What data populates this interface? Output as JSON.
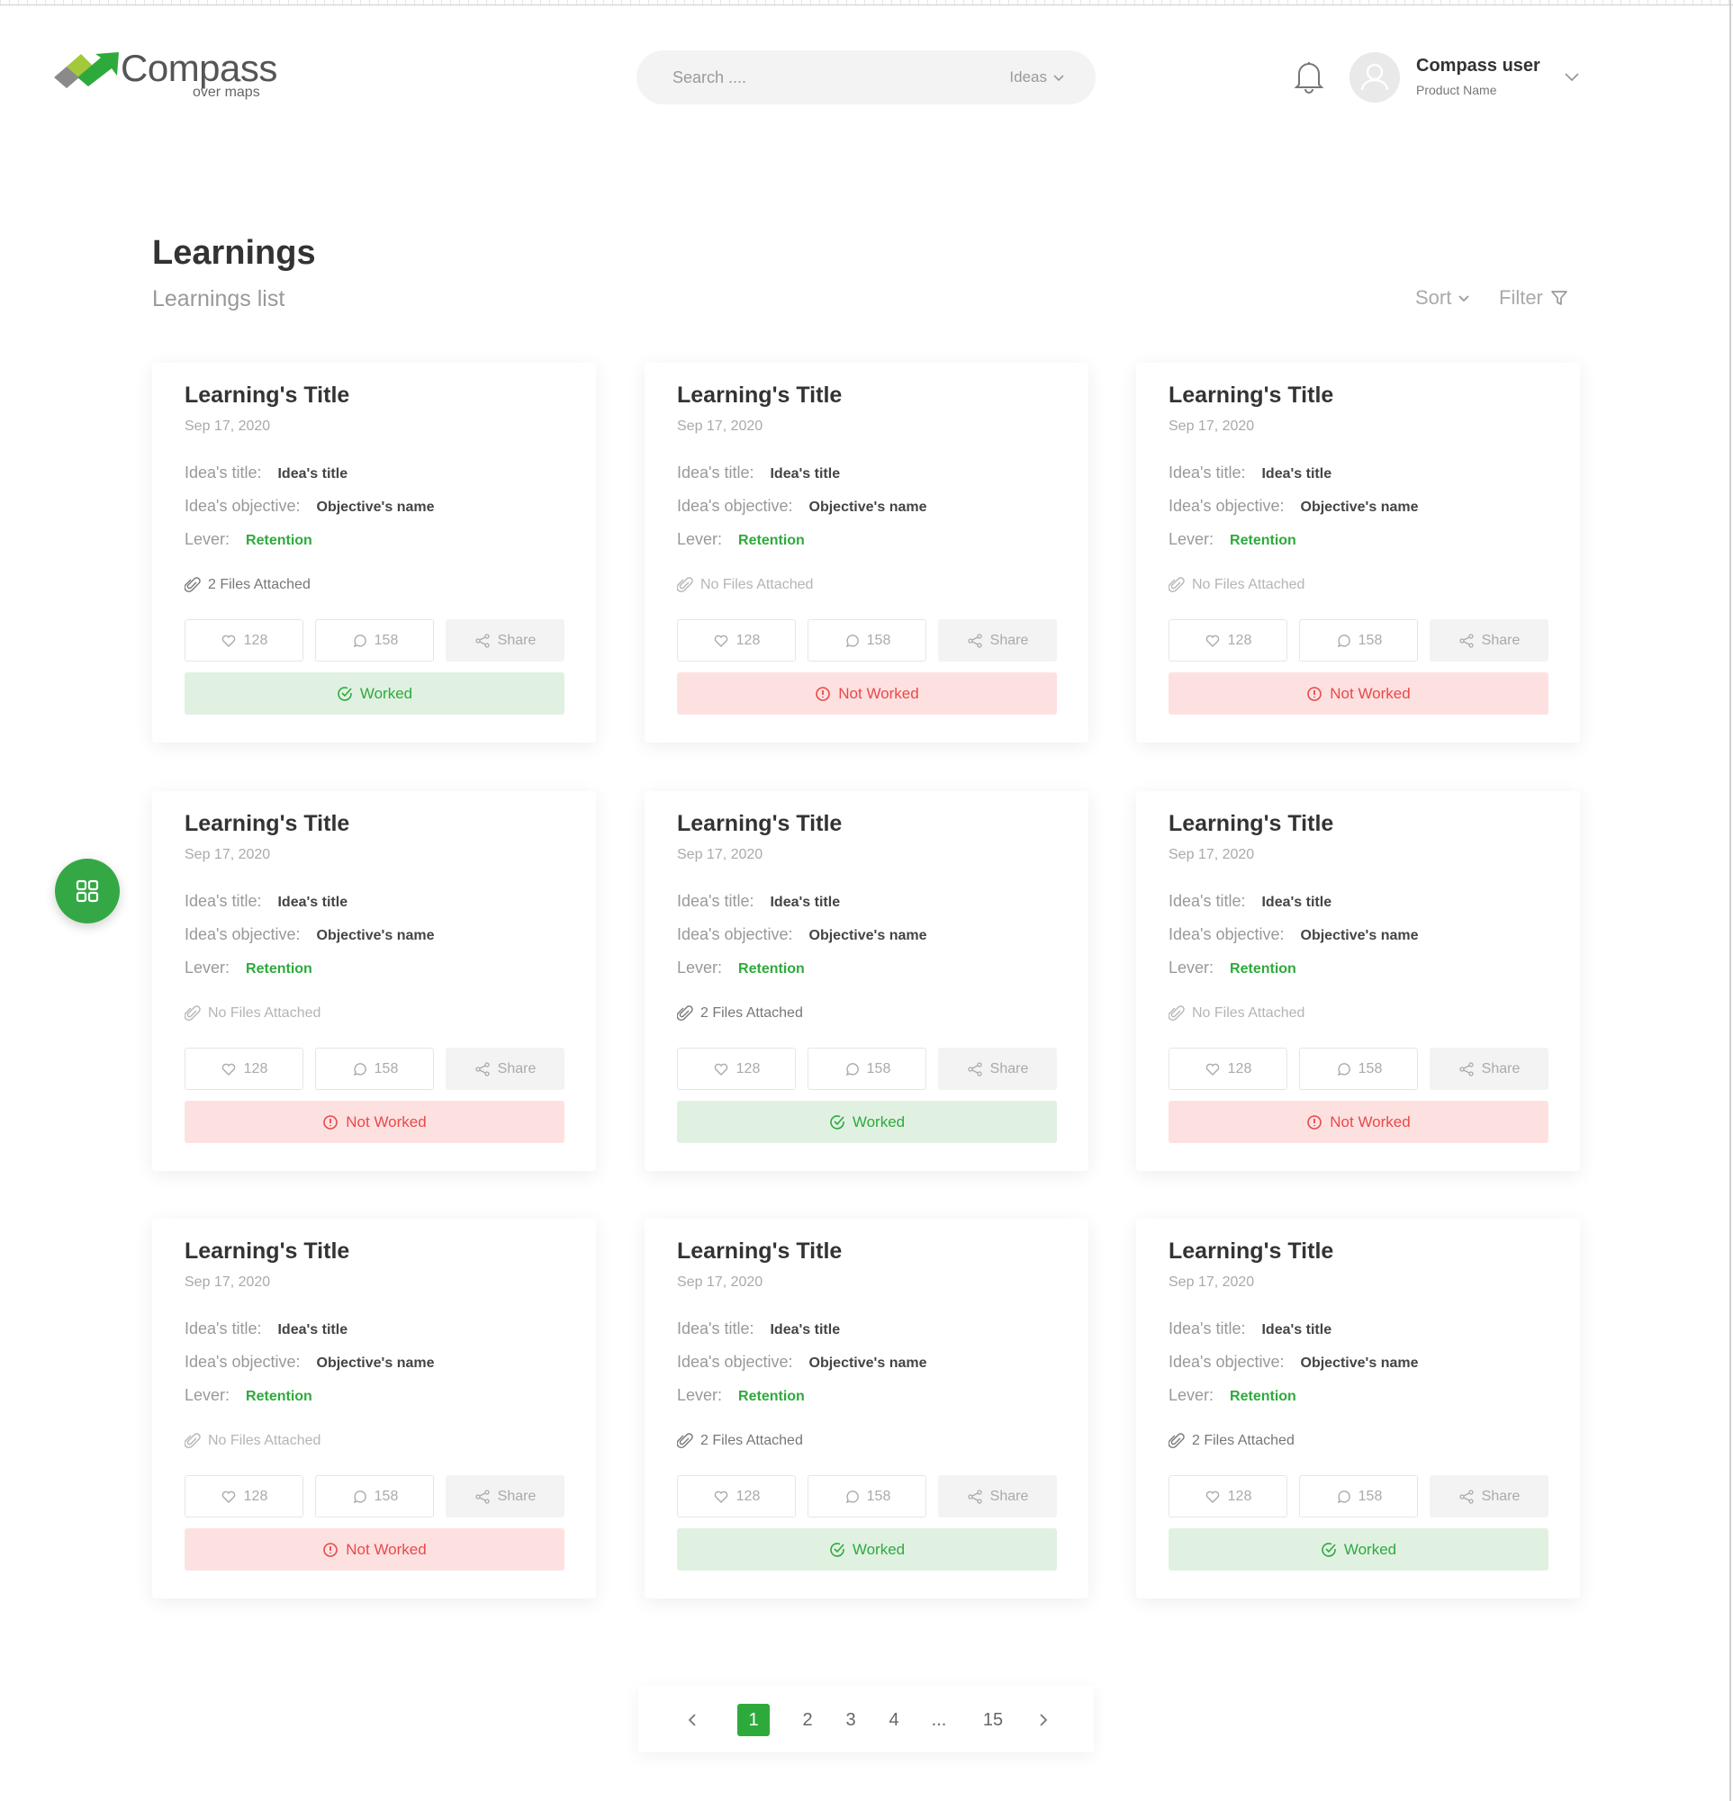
{
  "brand": {
    "name": "Compass",
    "tagline": "over maps",
    "green": "#2eaa3c",
    "red": "#ea4848"
  },
  "search": {
    "placeholder": "Search ....",
    "scope": "Ideas"
  },
  "user": {
    "name": "Compass user",
    "product": "Product Name"
  },
  "page": {
    "title": "Learnings",
    "subtitle": "Learnings list",
    "sort_label": "Sort",
    "filter_label": "Filter"
  },
  "labels": {
    "idea_title": "Idea's title:",
    "idea_objective": "Idea's objective:",
    "lever": "Lever:",
    "share": "Share",
    "worked": "Worked",
    "not_worked": "Not Worked"
  },
  "cards": [
    {
      "title": "Learning's Title",
      "date": "Sep 17, 2020",
      "idea_title": "Idea's title",
      "objective": "Objective's name",
      "lever": "Retention",
      "files": "2 Files Attached",
      "has_files": true,
      "likes": "128",
      "comments": "158",
      "status": "Worked"
    },
    {
      "title": "Learning's Title",
      "date": "Sep 17, 2020",
      "idea_title": "Idea's title",
      "objective": "Objective's name",
      "lever": "Retention",
      "files": "No Files Attached",
      "has_files": false,
      "likes": "128",
      "comments": "158",
      "status": "Not Worked"
    },
    {
      "title": "Learning's Title",
      "date": "Sep 17, 2020",
      "idea_title": "Idea's title",
      "objective": "Objective's name",
      "lever": "Retention",
      "files": "No Files Attached",
      "has_files": false,
      "likes": "128",
      "comments": "158",
      "status": "Not Worked"
    },
    {
      "title": "Learning's Title",
      "date": "Sep 17, 2020",
      "idea_title": "Idea's title",
      "objective": "Objective's name",
      "lever": "Retention",
      "files": "No Files Attached",
      "has_files": false,
      "likes": "128",
      "comments": "158",
      "status": "Not Worked"
    },
    {
      "title": "Learning's Title",
      "date": "Sep 17, 2020",
      "idea_title": "Idea's title",
      "objective": "Objective's name",
      "lever": "Retention",
      "files": "2 Files Attached",
      "has_files": true,
      "likes": "128",
      "comments": "158",
      "status": "Worked"
    },
    {
      "title": "Learning's Title",
      "date": "Sep 17, 2020",
      "idea_title": "Idea's title",
      "objective": "Objective's name",
      "lever": "Retention",
      "files": "No Files Attached",
      "has_files": false,
      "likes": "128",
      "comments": "158",
      "status": "Not Worked"
    },
    {
      "title": "Learning's Title",
      "date": "Sep 17, 2020",
      "idea_title": "Idea's title",
      "objective": "Objective's name",
      "lever": "Retention",
      "files": "No Files Attached",
      "has_files": false,
      "likes": "128",
      "comments": "158",
      "status": "Not Worked"
    },
    {
      "title": "Learning's Title",
      "date": "Sep 17, 2020",
      "idea_title": "Idea's title",
      "objective": "Objective's name",
      "lever": "Retention",
      "files": "2 Files Attached",
      "has_files": true,
      "likes": "128",
      "comments": "158",
      "status": "Worked"
    },
    {
      "title": "Learning's Title",
      "date": "Sep 17, 2020",
      "idea_title": "Idea's title",
      "objective": "Objective's name",
      "lever": "Retention",
      "files": "2 Files Attached",
      "has_files": true,
      "likes": "128",
      "comments": "158",
      "status": "Worked"
    }
  ],
  "pagination": {
    "pages": [
      "1",
      "2",
      "3",
      "4",
      "...",
      "15"
    ],
    "current": "1"
  }
}
